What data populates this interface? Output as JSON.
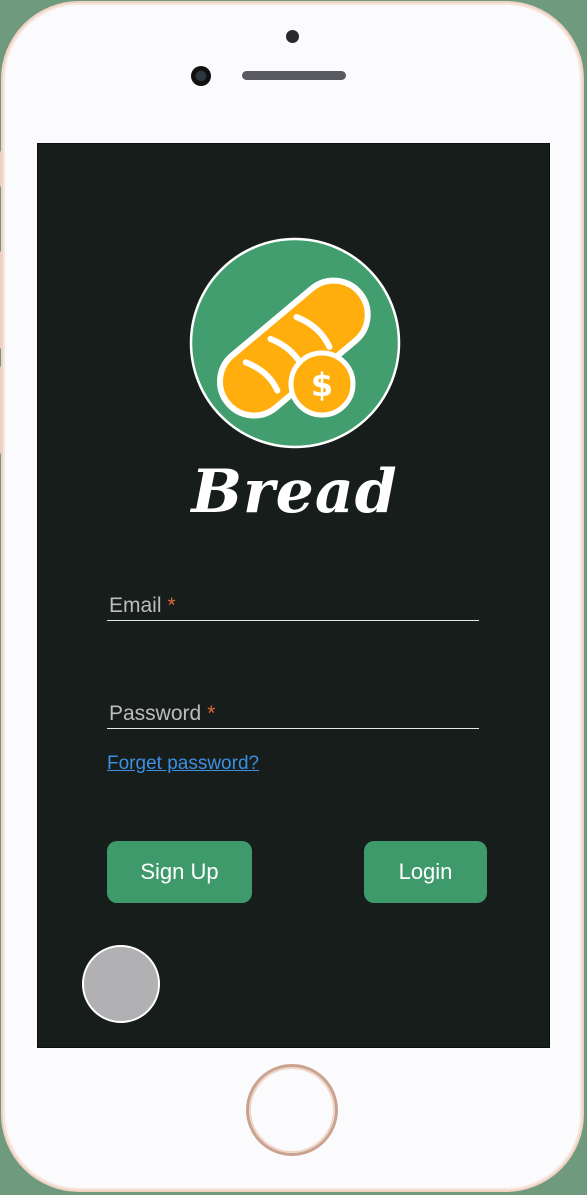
{
  "app": {
    "brand_name": "Bread"
  },
  "login_form": {
    "email_label": "Email",
    "password_label": "Password",
    "required_marker": "*",
    "forget_password_link": "Forget password?",
    "signup_button": "Sign Up",
    "login_button": "Login"
  },
  "logo": {
    "icon": "bread-dollar-logo",
    "colors": {
      "circle": "#429e6e",
      "bread": "#ffae0d",
      "coin": "#ffae0d"
    }
  },
  "theme": {
    "screen_background": "#161d1b",
    "button_color": "#3f9a6b",
    "link_color": "#3d8fe0",
    "required_color": "#e0683c"
  }
}
